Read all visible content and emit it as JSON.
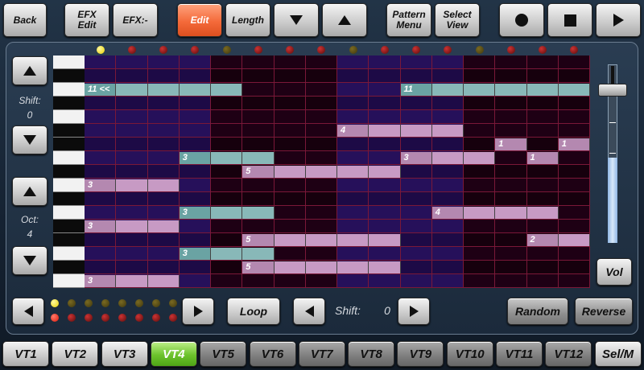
{
  "toolbar": {
    "back": "Back",
    "efx_edit": "EFX\nEdit",
    "efx_minus": "EFX:-",
    "edit": "Edit",
    "length": "Length",
    "pattern_menu": "Pattern\nMenu",
    "select_view": "Select\nView"
  },
  "left_panel": {
    "shift_label": "Shift:",
    "shift_value": "0",
    "oct_label": "Oct:",
    "oct_value": "4"
  },
  "bottom_controls": {
    "loop": "Loop",
    "shift_label": "Shift:",
    "shift_value": "0",
    "random": "Random",
    "reverse": "Reverse",
    "vol": "Vol"
  },
  "tracks": [
    "VT1",
    "VT2",
    "VT3",
    "VT4",
    "VT5",
    "VT6",
    "VT7",
    "VT8",
    "VT9",
    "VT10",
    "VT11",
    "VT12",
    "Sel/M"
  ],
  "active_track": "VT4",
  "colors": {
    "accent_edit": "#f46a3a",
    "active_track": "#6cc22c",
    "note_teal": "#88b8b8",
    "note_pink": "#c79ac4"
  },
  "grid": {
    "columns": 16,
    "rows": 16,
    "playhead_column": 0,
    "notes": [
      {
        "row": 2,
        "start": 0,
        "len": 5,
        "label": "11 <<",
        "color": "teal"
      },
      {
        "row": 2,
        "start": 10,
        "len": 6,
        "label": "11",
        "color": "teal"
      },
      {
        "row": 5,
        "start": 8,
        "len": 4,
        "label": "4",
        "color": "pink"
      },
      {
        "row": 6,
        "start": 13,
        "len": 1,
        "label": "1",
        "color": "pink"
      },
      {
        "row": 6,
        "start": 15,
        "len": 1,
        "label": "1",
        "color": "pink"
      },
      {
        "row": 7,
        "start": 3,
        "len": 3,
        "label": "3",
        "color": "teal"
      },
      {
        "row": 7,
        "start": 10,
        "len": 3,
        "label": "3",
        "color": "pink"
      },
      {
        "row": 7,
        "start": 14,
        "len": 1,
        "label": "1",
        "color": "pink"
      },
      {
        "row": 8,
        "start": 5,
        "len": 5,
        "label": "5",
        "color": "pink"
      },
      {
        "row": 9,
        "start": 0,
        "len": 3,
        "label": "3",
        "color": "pink"
      },
      {
        "row": 11,
        "start": 3,
        "len": 3,
        "label": "3",
        "color": "teal"
      },
      {
        "row": 11,
        "start": 11,
        "len": 4,
        "label": "4",
        "color": "pink"
      },
      {
        "row": 12,
        "start": 0,
        "len": 3,
        "label": "3",
        "color": "pink"
      },
      {
        "row": 13,
        "start": 5,
        "len": 5,
        "label": "5",
        "color": "pink"
      },
      {
        "row": 13,
        "start": 14,
        "len": 2,
        "label": "2",
        "color": "pink"
      },
      {
        "row": 14,
        "start": 3,
        "len": 3,
        "label": "3",
        "color": "teal"
      },
      {
        "row": 15,
        "start": 5,
        "len": 5,
        "label": "5",
        "color": "pink"
      },
      {
        "row": 16,
        "start": 0,
        "len": 3,
        "label": "3",
        "color": "pink"
      }
    ]
  },
  "column_leds": [
    "yellow",
    "red",
    "red",
    "red",
    "olive",
    "red",
    "red",
    "red",
    "olive",
    "red",
    "red",
    "red",
    "olive",
    "red",
    "red",
    "red"
  ],
  "pattern_leds": {
    "row1": [
      "yellow",
      "olive",
      "olive",
      "olive",
      "olive",
      "olive",
      "olive",
      "olive"
    ],
    "row2": [
      "red-bright",
      "red",
      "red",
      "red",
      "red",
      "red",
      "red",
      "red"
    ]
  },
  "volume_level": 0.85,
  "icons": {
    "up": "triangle-up-icon",
    "down": "triangle-down-icon",
    "record": "record-icon",
    "stop": "stop-icon",
    "play": "play-icon"
  }
}
